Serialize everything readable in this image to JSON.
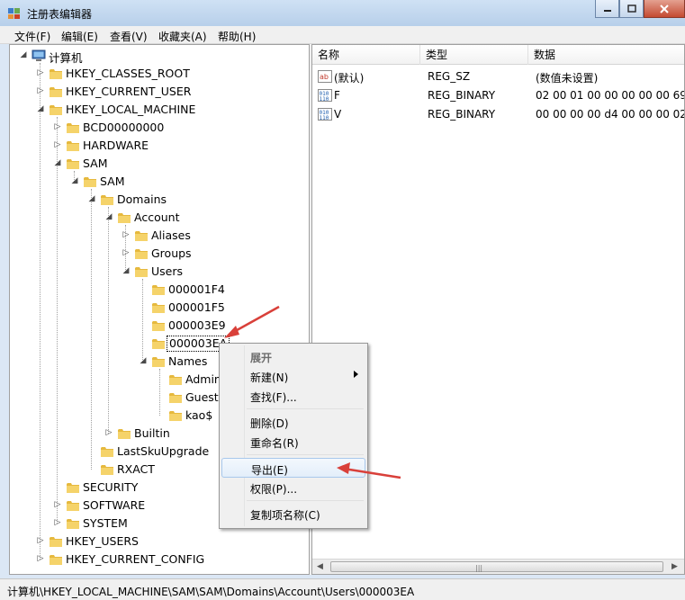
{
  "window": {
    "title": "注册表编辑器"
  },
  "menu": [
    "文件(F)",
    "编辑(E)",
    "查看(V)",
    "收藏夹(A)",
    "帮助(H)"
  ],
  "tree": {
    "nodes": [
      {
        "label": "计算机",
        "icon": "computer-icon",
        "expander": "expanded"
      },
      {
        "label": "HKEY_CLASSES_ROOT",
        "icon": "folder-icon",
        "expander": "collapsed"
      },
      {
        "label": "HKEY_CURRENT_USER",
        "icon": "folder-icon",
        "expander": "collapsed"
      },
      {
        "label": "HKEY_LOCAL_MACHINE",
        "icon": "folder-icon",
        "expander": "expanded"
      },
      {
        "label": "BCD00000000",
        "icon": "folder-icon",
        "expander": "collapsed"
      },
      {
        "label": "HARDWARE",
        "icon": "folder-icon",
        "expander": "collapsed"
      },
      {
        "label": "SAM",
        "icon": "folder-icon",
        "expander": "expanded"
      },
      {
        "label": "SAM",
        "icon": "folder-icon",
        "expander": "expanded"
      },
      {
        "label": "Domains",
        "icon": "folder-icon",
        "expander": "expanded"
      },
      {
        "label": "Account",
        "icon": "folder-icon",
        "expander": "expanded"
      },
      {
        "label": "Aliases",
        "icon": "folder-icon",
        "expander": "collapsed"
      },
      {
        "label": "Groups",
        "icon": "folder-icon",
        "expander": "collapsed"
      },
      {
        "label": "Users",
        "icon": "folder-icon",
        "expander": "expanded"
      },
      {
        "label": "000001F4",
        "icon": "folder-icon",
        "expander": "none"
      },
      {
        "label": "000001F5",
        "icon": "folder-icon",
        "expander": "none"
      },
      {
        "label": "000003E9",
        "icon": "folder-icon",
        "expander": "none"
      },
      {
        "label": "000003EA",
        "icon": "folder-icon",
        "expander": "none",
        "selected": true
      },
      {
        "label": "Names",
        "icon": "folder-icon",
        "expander": "expanded"
      },
      {
        "label": "Admin",
        "icon": "folder-icon",
        "expander": "none"
      },
      {
        "label": "Guest",
        "icon": "folder-icon",
        "expander": "none"
      },
      {
        "label": "kao$",
        "icon": "folder-icon",
        "expander": "none"
      },
      {
        "label": "Builtin",
        "icon": "folder-icon",
        "expander": "collapsed"
      },
      {
        "label": "LastSkuUpgrade",
        "icon": "folder-icon",
        "expander": "none"
      },
      {
        "label": "RXACT",
        "icon": "folder-icon",
        "expander": "none"
      },
      {
        "label": "SECURITY",
        "icon": "folder-icon",
        "expander": "none"
      },
      {
        "label": "SOFTWARE",
        "icon": "folder-icon",
        "expander": "collapsed"
      },
      {
        "label": "SYSTEM",
        "icon": "folder-icon",
        "expander": "collapsed"
      },
      {
        "label": "HKEY_USERS",
        "icon": "folder-icon",
        "expander": "collapsed"
      },
      {
        "label": "HKEY_CURRENT_CONFIG",
        "icon": "folder-icon",
        "expander": "collapsed"
      }
    ]
  },
  "list": {
    "headers": {
      "name": "名称",
      "type": "类型",
      "data": "数据"
    },
    "rows": [
      {
        "name": "(默认)",
        "type": "REG_SZ",
        "data": "(数值未设置)",
        "icon": "string-value-icon"
      },
      {
        "name": "F",
        "type": "REG_BINARY",
        "data": "02 00 01 00 00 00 00 00 69 6",
        "icon": "binary-value-icon"
      },
      {
        "name": "V",
        "type": "REG_BINARY",
        "data": "00 00 00 00 d4 00 00 00 02 0",
        "icon": "binary-value-icon"
      }
    ]
  },
  "context_menu": {
    "items": [
      {
        "label": "展开",
        "disabled": true
      },
      {
        "label": "新建(N)",
        "submenu": true
      },
      {
        "label": "查找(F)..."
      },
      {
        "separator": true
      },
      {
        "label": "删除(D)"
      },
      {
        "label": "重命名(R)"
      },
      {
        "separator": true
      },
      {
        "label": "导出(E)",
        "highlighted": true
      },
      {
        "label": "权限(P)..."
      },
      {
        "separator": true
      },
      {
        "label": "复制项名称(C)"
      }
    ]
  },
  "status": "计算机\\HKEY_LOCAL_MACHINE\\SAM\\SAM\\Domains\\Account\\Users\\000003EA",
  "colors": {
    "annotation_arrow": "#d9403a",
    "selection_border": "#a8c8ec",
    "folder": "#f0c94f"
  }
}
